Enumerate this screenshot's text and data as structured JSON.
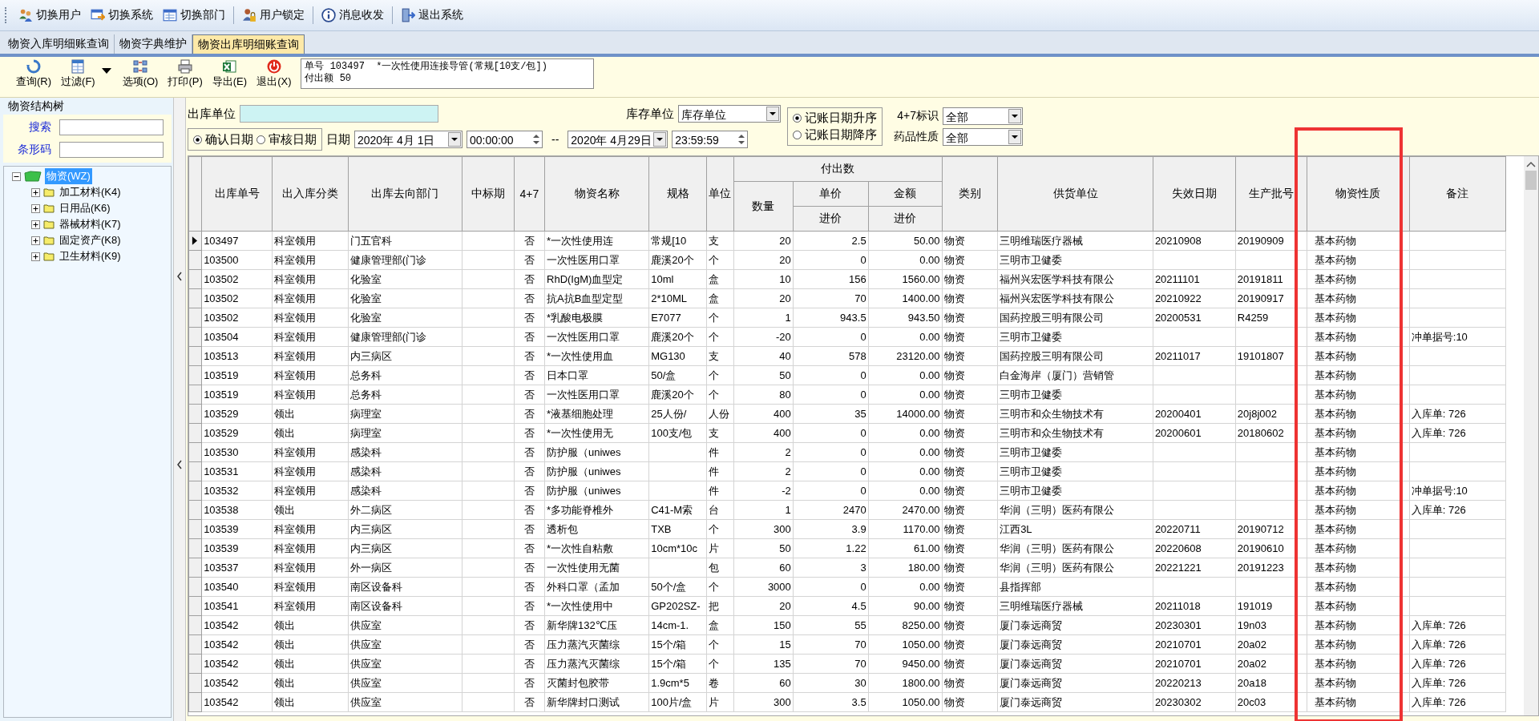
{
  "menu": [
    {
      "label": "切换用户",
      "kind": "user"
    },
    {
      "label": "切换系统",
      "kind": "system"
    },
    {
      "label": "切换部门",
      "kind": "department"
    },
    {
      "label": "用户锁定",
      "kind": "lock"
    },
    {
      "label": "消息收发",
      "kind": "message"
    },
    {
      "label": "退出系统",
      "kind": "exit"
    }
  ],
  "tabs": [
    {
      "label": "物资入库明细账查询",
      "selected": false
    },
    {
      "label": "物资字典维护",
      "selected": false
    },
    {
      "label": "物资出库明细账查询",
      "selected": true
    }
  ],
  "toolbar": [
    {
      "label": "查询(R)",
      "kind": "query"
    },
    {
      "label": "过滤(F)",
      "kind": "filter"
    },
    {
      "label": "选项(O)",
      "kind": "options"
    },
    {
      "label": "打印(P)",
      "kind": "print"
    },
    {
      "label": "导出(E)",
      "kind": "export"
    },
    {
      "label": "退出(X)",
      "kind": "exit"
    }
  ],
  "info": {
    "lines": [
      "单号 103497  *一次性使用连接导管(常规[10支/包])",
      "付出额 50"
    ]
  },
  "sidebar": {
    "title": "物资结构树",
    "search_label": "搜索",
    "barcode_label": "条形码",
    "tree": [
      {
        "label": "物资(WZ)",
        "expanded": true,
        "selected": true,
        "children": [
          {
            "label": "加工材料(K4)",
            "expanded": false,
            "selected": false
          },
          {
            "label": "日用品(K6)",
            "expanded": false,
            "selected": false
          },
          {
            "label": "器械材料(K7)",
            "expanded": false,
            "selected": false
          },
          {
            "label": "固定资产(K8)",
            "expanded": false,
            "selected": false
          },
          {
            "label": "卫生材料(K9)",
            "expanded": false,
            "selected": false
          }
        ]
      }
    ]
  },
  "filters": {
    "outbound_unit": {
      "label": "出库单位"
    },
    "stock_unit": {
      "label": "库存单位",
      "value": "库存单位"
    },
    "date_type": [
      {
        "label": "确认日期",
        "selected": true
      },
      {
        "label": "审核日期",
        "selected": false
      }
    ],
    "date_label": "日期",
    "start_date": "2020年 4月 1日",
    "start_time": "00:00:00",
    "separator": "--",
    "end_date": "2020年 4月29日",
    "end_time": "23:59:59",
    "sort": [
      {
        "label": "记账日期升序",
        "selected": true
      },
      {
        "label": "记账日期降序",
        "selected": false
      }
    ],
    "flag_47": {
      "label": "4+7标识",
      "value": "全部"
    },
    "drug_nature": {
      "label": "药品性质",
      "value": "全部"
    }
  },
  "table": {
    "columns_before": [
      "出库单号",
      "出入库分类",
      "出库去向部门",
      "中标期",
      "4+7",
      "物资名称",
      "规格",
      "单位"
    ],
    "group": {
      "label": "付出数",
      "columns": [
        {
          "label": "数量"
        },
        {
          "label": "单价",
          "sub": "进价"
        },
        {
          "label": "金额",
          "sub": "进价"
        }
      ]
    },
    "columns_after": [
      "类别",
      "供货单位",
      "失效日期",
      "生产批号",
      "物资性质",
      "备注"
    ],
    "rows": [
      {
        "selected": true,
        "no": "103497",
        "type": "科室领用",
        "dept": "门五官科",
        "f47": "否",
        "name": "*一次性使用连",
        "spec": "常规[10",
        "unit": "支",
        "qty": "20",
        "price": "2.5",
        "amount": "50.00",
        "cat": "物资",
        "supplier": "三明维瑞医疗器械",
        "expiry": "20210908",
        "batch": "20190909",
        "nature": "基本药物"
      },
      {
        "selected": false,
        "no": "103500",
        "type": "科室领用",
        "dept": "健康管理部(门诊",
        "f47": "否",
        "name": "一次性医用口罩",
        "spec": "鹿溪20个",
        "unit": "个",
        "qty": "20",
        "price": "0",
        "amount": "0.00",
        "cat": "物资",
        "supplier": "三明市卫健委",
        "nature": "基本药物"
      },
      {
        "selected": false,
        "no": "103502",
        "type": "科室领用",
        "dept": "化验室",
        "f47": "否",
        "name": "RhD(IgM)血型定",
        "spec": "10ml",
        "unit": "盒",
        "qty": "10",
        "price": "156",
        "amount": "1560.00",
        "cat": "物资",
        "supplier": "福州兴宏医学科技有限公",
        "expiry": "20211101",
        "batch": "20191811",
        "nature": "基本药物"
      },
      {
        "selected": false,
        "no": "103502",
        "type": "科室领用",
        "dept": "化验室",
        "f47": "否",
        "name": "抗A抗B血型定型",
        "spec": "2*10ML",
        "unit": "盒",
        "qty": "20",
        "price": "70",
        "amount": "1400.00",
        "cat": "物资",
        "supplier": "福州兴宏医学科技有限公",
        "expiry": "20210922",
        "batch": "20190917",
        "nature": "基本药物"
      },
      {
        "selected": false,
        "no": "103502",
        "type": "科室领用",
        "dept": "化验室",
        "f47": "否",
        "name": "*乳酸电极膜",
        "spec": "E7077",
        "unit": "个",
        "qty": "1",
        "price": "943.5",
        "amount": "943.50",
        "cat": "物资",
        "supplier": "国药控股三明有限公司",
        "expiry": "20200531",
        "batch": "R4259",
        "nature": "基本药物"
      },
      {
        "selected": false,
        "no": "103504",
        "type": "科室领用",
        "dept": "健康管理部(门诊",
        "f47": "否",
        "name": "一次性医用口罩",
        "spec": "鹿溪20个",
        "unit": "个",
        "qty": "-20",
        "price": "0",
        "amount": "0.00",
        "cat": "物资",
        "supplier": "三明市卫健委",
        "nature": "基本药物",
        "note": "冲单据号:10"
      },
      {
        "selected": false,
        "no": "103513",
        "type": "科室领用",
        "dept": "内三病区",
        "f47": "否",
        "name": "*一次性使用血",
        "spec": "MG130",
        "unit": "支",
        "qty": "40",
        "price": "578",
        "amount": "23120.00",
        "cat": "物资",
        "supplier": "国药控股三明有限公司",
        "expiry": "20211017",
        "batch": "19101807",
        "nature": "基本药物"
      },
      {
        "selected": false,
        "no": "103519",
        "type": "科室领用",
        "dept": "总务科",
        "f47": "否",
        "name": "日本口罩",
        "spec": "50/盒",
        "unit": "个",
        "qty": "50",
        "price": "0",
        "amount": "0.00",
        "cat": "物资",
        "supplier": "白金海岸（厦门）营销管",
        "nature": "基本药物"
      },
      {
        "selected": false,
        "no": "103519",
        "type": "科室领用",
        "dept": "总务科",
        "f47": "否",
        "name": "一次性医用口罩",
        "spec": "鹿溪20个",
        "unit": "个",
        "qty": "80",
        "price": "0",
        "amount": "0.00",
        "cat": "物资",
        "supplier": "三明市卫健委",
        "nature": "基本药物"
      },
      {
        "selected": false,
        "no": "103529",
        "type": "领出",
        "dept": "病理室",
        "f47": "否",
        "name": "*液基细胞处理",
        "spec": "25人份/",
        "unit": "人份",
        "qty": "400",
        "price": "35",
        "amount": "14000.00",
        "cat": "物资",
        "supplier": "三明市和众生物技术有",
        "expiry": "20200401",
        "batch": "20j8j002",
        "nature": "基本药物",
        "note": "入库单: 726"
      },
      {
        "selected": false,
        "no": "103529",
        "type": "领出",
        "dept": "病理室",
        "f47": "否",
        "name": "*一次性使用无",
        "spec": "100支/包",
        "unit": "支",
        "qty": "400",
        "price": "0",
        "amount": "0.00",
        "cat": "物资",
        "supplier": "三明市和众生物技术有",
        "expiry": "20200601",
        "batch": "20180602",
        "nature": "基本药物",
        "note": "入库单: 726"
      },
      {
        "selected": false,
        "no": "103530",
        "type": "科室领用",
        "dept": "感染科",
        "f47": "否",
        "name": "防护服（uniwes",
        "unit": "件",
        "qty": "2",
        "price": "0",
        "amount": "0.00",
        "cat": "物资",
        "supplier": "三明市卫健委",
        "nature": "基本药物"
      },
      {
        "selected": false,
        "no": "103531",
        "type": "科室领用",
        "dept": "感染科",
        "f47": "否",
        "name": "防护服（uniwes",
        "unit": "件",
        "qty": "2",
        "price": "0",
        "amount": "0.00",
        "cat": "物资",
        "supplier": "三明市卫健委",
        "nature": "基本药物"
      },
      {
        "selected": false,
        "no": "103532",
        "type": "科室领用",
        "dept": "感染科",
        "f47": "否",
        "name": "防护服（uniwes",
        "unit": "件",
        "qty": "-2",
        "price": "0",
        "amount": "0.00",
        "cat": "物资",
        "supplier": "三明市卫健委",
        "nature": "基本药物",
        "note": "冲单据号:10"
      },
      {
        "selected": false,
        "no": "103538",
        "type": "领出",
        "dept": "外二病区",
        "f47": "否",
        "name": "*多功能脊椎外",
        "spec": "C41-M索",
        "unit": "台",
        "qty": "1",
        "price": "2470",
        "amount": "2470.00",
        "cat": "物资",
        "supplier": "华润（三明）医药有限公",
        "nature": "基本药物",
        "note": "入库单: 726"
      },
      {
        "selected": false,
        "no": "103539",
        "type": "科室领用",
        "dept": "内三病区",
        "f47": "否",
        "name": "透析包",
        "spec": "TXB",
        "unit": "个",
        "qty": "300",
        "price": "3.9",
        "amount": "1170.00",
        "cat": "物资",
        "supplier": "江西3L",
        "expiry": "20220711",
        "batch": "20190712",
        "nature": "基本药物"
      },
      {
        "selected": false,
        "no": "103539",
        "type": "科室领用",
        "dept": "内三病区",
        "f47": "否",
        "name": "*一次性自粘敷",
        "spec": "10cm*10c",
        "unit": "片",
        "qty": "50",
        "price": "1.22",
        "amount": "61.00",
        "cat": "物资",
        "supplier": "华润（三明）医药有限公",
        "expiry": "20220608",
        "batch": "20190610",
        "nature": "基本药物"
      },
      {
        "selected": false,
        "no": "103537",
        "type": "科室领用",
        "dept": "外一病区",
        "f47": "否",
        "name": "一次性使用无菌",
        "unit": "包",
        "qty": "60",
        "price": "3",
        "amount": "180.00",
        "cat": "物资",
        "supplier": "华润（三明）医药有限公",
        "expiry": "20221221",
        "batch": "20191223",
        "nature": "基本药物"
      },
      {
        "selected": false,
        "no": "103540",
        "type": "科室领用",
        "dept": "南区设备科",
        "f47": "否",
        "name": "外科口罩（孟加",
        "spec": "50个/盒",
        "unit": "个",
        "qty": "3000",
        "price": "0",
        "amount": "0.00",
        "cat": "物资",
        "supplier": "县指挥部",
        "nature": "基本药物"
      },
      {
        "selected": false,
        "no": "103541",
        "type": "科室领用",
        "dept": "南区设备科",
        "f47": "否",
        "name": "*一次性使用中",
        "spec": "GP202SZ-",
        "unit": "把",
        "qty": "20",
        "price": "4.5",
        "amount": "90.00",
        "cat": "物资",
        "supplier": "三明维瑞医疗器械",
        "expiry": "20211018",
        "batch": "191019",
        "nature": "基本药物"
      },
      {
        "selected": false,
        "no": "103542",
        "type": "领出",
        "dept": "供应室",
        "f47": "否",
        "name": "新华牌132℃压",
        "spec": "14cm-1.",
        "unit": "盒",
        "qty": "150",
        "price": "55",
        "amount": "8250.00",
        "cat": "物资",
        "supplier": "厦门泰远商贸",
        "expiry": "20230301",
        "batch": "19n03",
        "nature": "基本药物",
        "note": "入库单: 726"
      },
      {
        "selected": false,
        "no": "103542",
        "type": "领出",
        "dept": "供应室",
        "f47": "否",
        "name": "压力蒸汽灭菌综",
        "spec": "15个/箱",
        "unit": "个",
        "qty": "15",
        "price": "70",
        "amount": "1050.00",
        "cat": "物资",
        "supplier": "厦门泰远商贸",
        "expiry": "20210701",
        "batch": "20a02",
        "nature": "基本药物",
        "note": "入库单: 726"
      },
      {
        "selected": false,
        "no": "103542",
        "type": "领出",
        "dept": "供应室",
        "f47": "否",
        "name": "压力蒸汽灭菌综",
        "spec": "15个/箱",
        "unit": "个",
        "qty": "135",
        "price": "70",
        "amount": "9450.00",
        "cat": "物资",
        "supplier": "厦门泰远商贸",
        "expiry": "20210701",
        "batch": "20a02",
        "nature": "基本药物",
        "note": "入库单: 726"
      },
      {
        "selected": false,
        "no": "103542",
        "type": "领出",
        "dept": "供应室",
        "f47": "否",
        "name": "灭菌封包胶带",
        "spec": "1.9cm*5",
        "unit": "卷",
        "qty": "60",
        "price": "30",
        "amount": "1800.00",
        "cat": "物资",
        "supplier": "厦门泰远商贸",
        "expiry": "20220213",
        "batch": "20a18",
        "nature": "基本药物",
        "note": "入库单: 726"
      },
      {
        "selected": false,
        "no": "103542",
        "type": "领出",
        "dept": "供应室",
        "f47": "否",
        "name": "新华牌封口测试",
        "spec": "100片/盒",
        "unit": "片",
        "qty": "300",
        "price": "3.5",
        "amount": "1050.00",
        "cat": "物资",
        "supplier": "厦门泰远商贸",
        "expiry": "20230302",
        "batch": "20c03",
        "nature": "基本药物",
        "note": "入库单: 726"
      }
    ]
  }
}
